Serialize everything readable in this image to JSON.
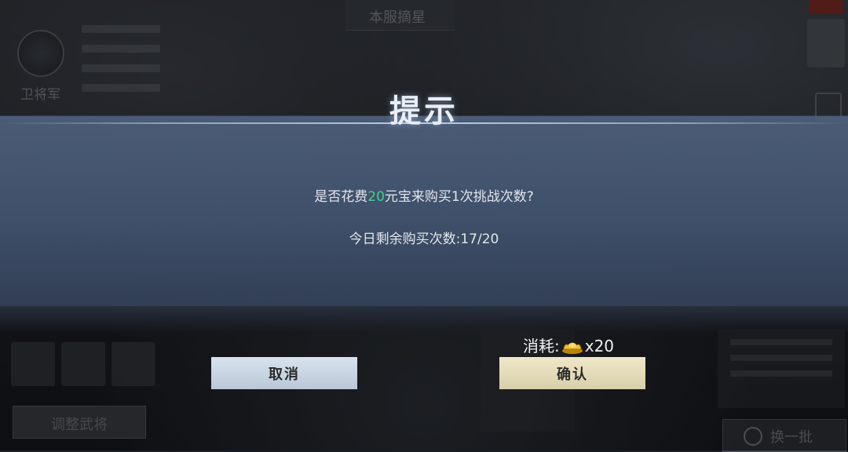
{
  "background": {
    "emblem_label": "卫将军",
    "top_tab": "本服摘星",
    "bottom_left_button": "调整武将",
    "bottom_right_button": "换一批"
  },
  "dialog": {
    "title": "提示",
    "message_prefix": "是否花费",
    "message_amount": "20",
    "message_suffix": "元宝来购买1次挑战次数?",
    "remaining_label": "今日剩余购买次数:",
    "remaining_value": "17/20",
    "cost_label": "消耗:",
    "cost_icon": "gold-ingot-icon",
    "cost_value": "x20",
    "cancel_label": "取消",
    "confirm_label": "确认",
    "highlight_color": "#3fd18e"
  }
}
